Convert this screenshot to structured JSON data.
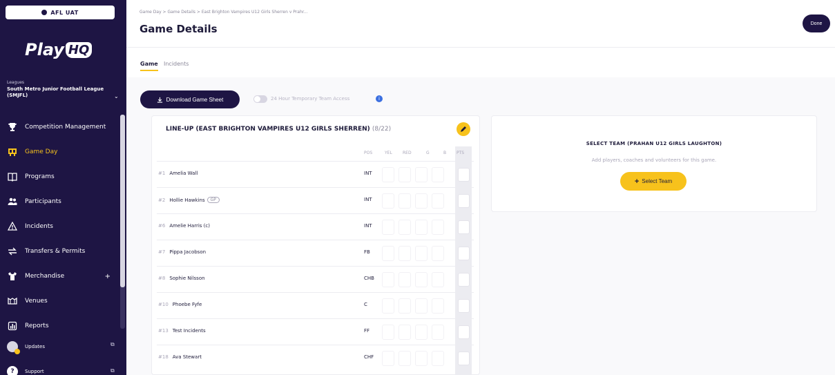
{
  "sidebar": {
    "env_badge": "AFL UAT",
    "logo_play": "Play",
    "logo_hq": "HQ",
    "org_caption": "Leagues",
    "org_name": "South Metro Junior Football League (SMJFL)",
    "items": [
      {
        "label": "Competition Management",
        "icon": "trophy-icon",
        "active": false
      },
      {
        "label": "Game Day",
        "icon": "scoreboard-icon",
        "active": true
      },
      {
        "label": "Programs",
        "icon": "book-icon",
        "active": false
      },
      {
        "label": "Participants",
        "icon": "people-icon",
        "active": false
      },
      {
        "label": "Incidents",
        "icon": "warning-icon",
        "active": false
      },
      {
        "label": "Transfers & Permits",
        "icon": "transfer-icon",
        "active": false
      },
      {
        "label": "Merchandise",
        "icon": "shirt-icon",
        "active": false,
        "plus": "+"
      },
      {
        "label": "Venues",
        "icon": "stadium-icon",
        "active": false
      },
      {
        "label": "Reports",
        "icon": "report-icon",
        "active": false
      }
    ],
    "updates_label": "Updates",
    "support_label": "Support"
  },
  "header": {
    "breadcrumb": "Game Day  >  Game Details  >  East Brighton Vampires U12 Girls Sherren v Prahr...",
    "title": "Game Details",
    "done_label": "Done"
  },
  "tabs": {
    "game": "Game",
    "incidents": "Incidents"
  },
  "toolbar": {
    "download_label": "Download Game Sheet",
    "toggle_label": "24 Hour Temporary Team Access",
    "toggle_on": false
  },
  "lineup": {
    "title": "LINE-UP (EAST BRIGHTON VAMPIRES U12 GIRLS SHERREN)",
    "count": "(8/22)",
    "columns": {
      "pos": "POS",
      "yel": "YEL",
      "red": "RED",
      "g": "G",
      "b": "B",
      "pts": "PTS"
    },
    "players": [
      {
        "num": "#1",
        "name": "Amelia Wall",
        "pos": "INT",
        "badge": ""
      },
      {
        "num": "#2",
        "name": "Hollie Hawkins",
        "pos": "INT",
        "badge": "GP"
      },
      {
        "num": "#6",
        "name": "Amelie Harris (c)",
        "pos": "INT",
        "badge": ""
      },
      {
        "num": "#7",
        "name": "Pippa Jacobson",
        "pos": "FB",
        "badge": ""
      },
      {
        "num": "#8",
        "name": "Sophie Nilsson",
        "pos": "CHB",
        "badge": ""
      },
      {
        "num": "#10",
        "name": "Phoebe Fyfe",
        "pos": "C",
        "badge": ""
      },
      {
        "num": "#13",
        "name": "Test Incidents",
        "pos": "FF",
        "badge": ""
      },
      {
        "num": "#18",
        "name": "Ava Stewart",
        "pos": "CHF",
        "badge": ""
      }
    ]
  },
  "select_team": {
    "title": "SELECT TEAM (PRAHAN U12 GIRLS LAUGHTON)",
    "subtitle": "Add players, coaches and volunteers for this game.",
    "button_label": "Select Team"
  },
  "colors": {
    "sidebar_bg": "#1e1544",
    "accent": "#f7c21c",
    "info": "#3b6fe0"
  }
}
